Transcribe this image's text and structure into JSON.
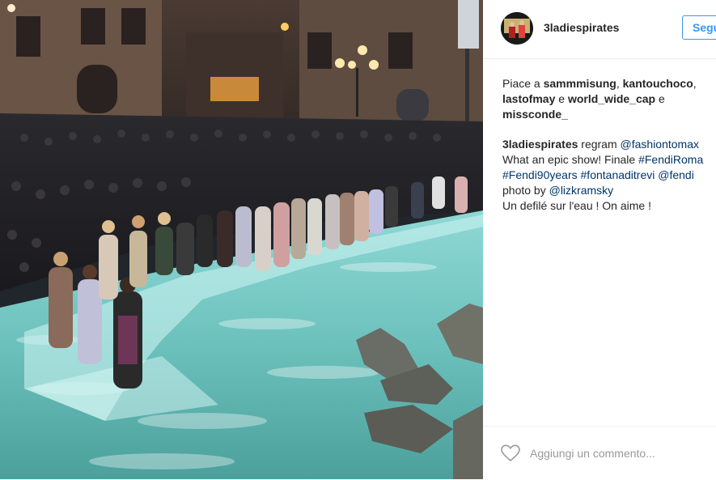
{
  "post": {
    "username": "3ladiespirates",
    "follow_label": "Segui",
    "avatar_icon": "user-avatar",
    "likes": {
      "prefix": "Piace a ",
      "users": [
        "sammmisung",
        "kantouchoco",
        "lastofmay",
        "world_wide_cap",
        "missconde_"
      ],
      "sep1": ", ",
      "sep2": ", ",
      "sep3": " e ",
      "sep4": " e "
    },
    "caption": {
      "author": "3ladiespirates",
      "regram": " regram ",
      "mention1": "@fashiontomax",
      "text1": "What an epic show! Finale ",
      "tag1": "#FendiRoma",
      "tag2": "#Fendi90years",
      "tag3": "#fontanaditrevi",
      "mention2": "@fendi",
      "photo_by": "photo by ",
      "mention3": "@lizkramsky",
      "text2": "Un defilé sur l'eau ! On aime !"
    },
    "comment_placeholder": "Aggiungi un commento..."
  },
  "colors": {
    "link": "#003569",
    "follow": "#3897f0",
    "text": "#262626",
    "placeholder": "#999999"
  }
}
